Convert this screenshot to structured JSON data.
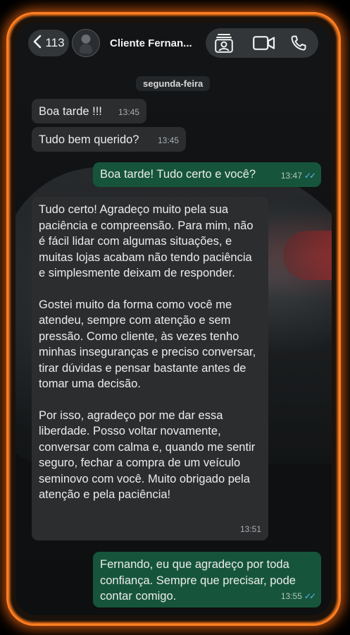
{
  "header": {
    "back_count": "113",
    "contact_name": "Cliente Fernan...",
    "icons": [
      "chevron-left-icon",
      "contact-card-icon",
      "video-call-icon",
      "phone-call-icon"
    ]
  },
  "date_chip": "segunda-feira",
  "messages": [
    {
      "direction": "in",
      "text": "Boa tarde !!!",
      "time": "13:45"
    },
    {
      "direction": "in",
      "text": "Tudo bem querido?",
      "time": "13:45"
    },
    {
      "direction": "out",
      "text": "Boa tarde! Tudo certo e você?",
      "time": "13:47",
      "status": "read"
    },
    {
      "direction": "in",
      "paragraphs": [
        "Tudo certo! Agradeço muito pela sua paciência e compreensão. Para mim, não é fácil lidar com algumas situações, e muitas lojas acabam não tendo paciência e simplesmente deixam de responder.",
        "Gostei muito da forma como você me atendeu, sempre com atenção e sem pressão. Como cliente, às vezes tenho minhas inseguranças e preciso conversar, tirar dúvidas e pensar bastante antes de tomar uma decisão.",
        "Por isso, agradeço por me dar essa liberdade. Posso voltar novamente, conversar com calma e, quando me sentir seguro, fechar a compra de um veículo seminovo com você. Muito obrigado pela atenção e pela paciência!"
      ],
      "time": "13:51"
    },
    {
      "direction": "out",
      "text": "Fernando, eu que agradeço por toda confiança. Sempre que precisar, pode contar comigo.",
      "time": "13:55",
      "status": "read"
    }
  ],
  "colors": {
    "glow": "#ff7f22",
    "incoming_bubble": "#2b2d2f",
    "outgoing_bubble": "#16553c",
    "read_ticks": "#59b6e8"
  }
}
